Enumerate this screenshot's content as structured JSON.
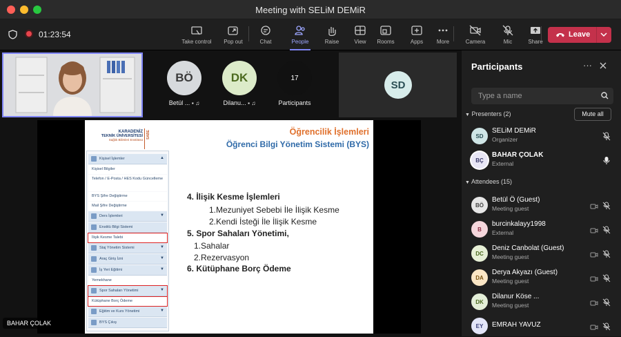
{
  "window": {
    "title": "Meeting with SELiM DEMiR"
  },
  "toolbar": {
    "timer": "01:23:54",
    "buttons": [
      {
        "label": "Take control",
        "icon": "take-control-icon"
      },
      {
        "label": "Pop out",
        "icon": "pop-out-icon"
      },
      {
        "label": "Chat",
        "icon": "chat-icon"
      },
      {
        "label": "People",
        "icon": "people-icon",
        "active": true
      },
      {
        "label": "Raise",
        "icon": "raise-hand-icon"
      },
      {
        "label": "View",
        "icon": "view-icon"
      },
      {
        "label": "Rooms",
        "icon": "rooms-icon"
      },
      {
        "label": "Apps",
        "icon": "apps-icon"
      },
      {
        "label": "More",
        "icon": "more-icon"
      },
      {
        "label": "Camera",
        "icon": "camera-off-icon"
      },
      {
        "label": "Mic",
        "icon": "mic-off-icon"
      },
      {
        "label": "Share",
        "icon": "share-icon"
      }
    ],
    "leave_label": "Leave"
  },
  "stage": {
    "tiles": [
      {
        "initials": "BÖ",
        "name": "Betül ..."
      },
      {
        "initials": "DK",
        "name": "Dilanu..."
      },
      {
        "initials": "17",
        "name": "Participants"
      },
      {
        "initials": "SD",
        "name": ""
      }
    ],
    "presenter_name": "BAHAR ÇOLAK"
  },
  "slide": {
    "logo_line1": "KARADENİZ",
    "logo_line2": "TEKNİK ÜNİVERSİTESİ",
    "logo_line3": "Sağlık Bilimleri Enstitüsü",
    "logo_side": "SABE",
    "title1": "Öğrencilik İşlemleri",
    "title2": "Öğrenci Bilgi Yönetim Sistemi (BYS)",
    "menu": [
      {
        "label": "Kişisel İşlemler",
        "type": "header",
        "icon": true,
        "chev": "up"
      },
      {
        "label": "Kişisel Bilgiler",
        "type": "item"
      },
      {
        "label": "Telefon / E-Posta / HES Kodu Güncelleme",
        "type": "item"
      },
      {
        "label": "BYS Şifre Değiştirme",
        "type": "item"
      },
      {
        "label": "Mail Şifre Değiştirme",
        "type": "item"
      },
      {
        "label": "Ders İşlemleri",
        "type": "header",
        "icon": true,
        "chev": "down"
      },
      {
        "label": "Enstitü Bilgi Sistemi",
        "type": "header",
        "icon": true,
        "chev": ""
      },
      {
        "label": "İlişik Kesme Talebi",
        "type": "item",
        "hl": true
      },
      {
        "label": "Staj Yönetim Sistemi",
        "type": "header",
        "icon": true,
        "chev": "down"
      },
      {
        "label": "Araç Giriş İzni",
        "type": "header",
        "icon": true,
        "chev": "down"
      },
      {
        "label": "İş Yeri Eğitimi",
        "type": "header",
        "icon": true,
        "chev": "down"
      },
      {
        "label": "Yemekhane",
        "type": "item"
      },
      {
        "label": "Spor Sahaları Yönetimi",
        "type": "header",
        "icon": true,
        "chev": "down",
        "hl": true
      },
      {
        "label": "Kütüphane Borç Ödeme",
        "type": "item",
        "hl": true
      },
      {
        "label": "Eğitim ve Kurs Yönetimi",
        "type": "header",
        "icon": true,
        "chev": "down"
      },
      {
        "label": "BYS Çıkış",
        "type": "header",
        "icon": true,
        "chev": ""
      }
    ],
    "content": [
      {
        "text": "4. İlişik Kesme İşlemleri",
        "bold": true,
        "indent": 0
      },
      {
        "text": "1.Mezuniyet Sebebi İle İlişik Kesme",
        "bold": false,
        "indent": 32
      },
      {
        "text": "2.Kendi İsteği İle İlişik Kesme",
        "bold": false,
        "indent": 32
      },
      {
        "text": "5. Spor Sahaları Yönetimi,",
        "bold": true,
        "indent": 0
      },
      {
        "text": "1.Sahalar",
        "bold": false,
        "indent": 10
      },
      {
        "text": "2.Rezervasyon",
        "bold": false,
        "indent": 10
      },
      {
        "text": "6. Kütüphane Borç Ödeme",
        "bold": true,
        "indent": 0
      }
    ]
  },
  "panel": {
    "title": "Participants",
    "search_placeholder": "Type a name",
    "presenters_label": "Presenters (2)",
    "mute_all": "Mute all",
    "attendees_label": "Attendees (15)",
    "presenters": [
      {
        "initials": "SD",
        "name": "SELiM DEMiR",
        "sub": "Organizer",
        "color": "#cfe5e6",
        "fg": "#2b4f55",
        "mic": "off"
      },
      {
        "initials": "BÇ",
        "name": "BAHAR ÇOLAK",
        "sub": "External",
        "color": "#e8e6f5",
        "fg": "#3a3a6a",
        "mic": "on",
        "selected": true
      }
    ],
    "attendees": [
      {
        "initials": "BÖ",
        "name": "Betül Ö (Guest)",
        "sub": "Meeting guest",
        "color": "#e6e6e6",
        "fg": "#444"
      },
      {
        "initials": "B",
        "name": "burcinkalayy1998",
        "sub": "External",
        "color": "#f5d6dc",
        "fg": "#8a2d42"
      },
      {
        "initials": "DC",
        "name": "Deniz Canbolat (Guest)",
        "sub": "Meeting guest",
        "color": "#e7f0d6",
        "fg": "#4c6a1f"
      },
      {
        "initials": "DA",
        "name": "Derya Akyazı (Guest)",
        "sub": "Meeting guest",
        "color": "#fbe6c5",
        "fg": "#7a5310"
      },
      {
        "initials": "DK",
        "name": "Dilanur Köse ...",
        "sub": "Meeting guest",
        "color": "#e4efd8",
        "fg": "#4c6a1f"
      },
      {
        "initials": "EY",
        "name": "EMRAH YAVUZ",
        "sub": "",
        "color": "#e3e5f8",
        "fg": "#3a3f7a"
      }
    ]
  }
}
